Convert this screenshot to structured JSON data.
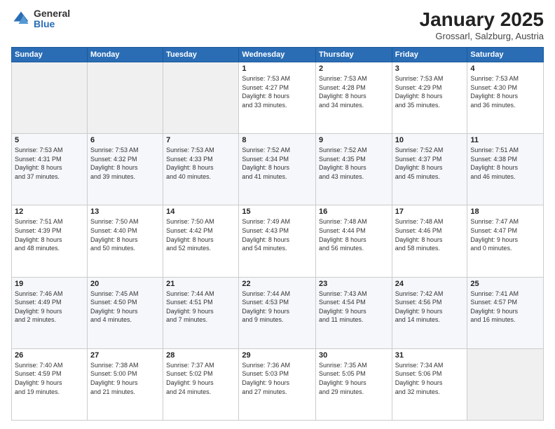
{
  "logo": {
    "general": "General",
    "blue": "Blue"
  },
  "header": {
    "title": "January 2025",
    "subtitle": "Grossarl, Salzburg, Austria"
  },
  "weekdays": [
    "Sunday",
    "Monday",
    "Tuesday",
    "Wednesday",
    "Thursday",
    "Friday",
    "Saturday"
  ],
  "weeks": [
    [
      {
        "day": "",
        "info": ""
      },
      {
        "day": "",
        "info": ""
      },
      {
        "day": "",
        "info": ""
      },
      {
        "day": "1",
        "info": "Sunrise: 7:53 AM\nSunset: 4:27 PM\nDaylight: 8 hours\nand 33 minutes."
      },
      {
        "day": "2",
        "info": "Sunrise: 7:53 AM\nSunset: 4:28 PM\nDaylight: 8 hours\nand 34 minutes."
      },
      {
        "day": "3",
        "info": "Sunrise: 7:53 AM\nSunset: 4:29 PM\nDaylight: 8 hours\nand 35 minutes."
      },
      {
        "day": "4",
        "info": "Sunrise: 7:53 AM\nSunset: 4:30 PM\nDaylight: 8 hours\nand 36 minutes."
      }
    ],
    [
      {
        "day": "5",
        "info": "Sunrise: 7:53 AM\nSunset: 4:31 PM\nDaylight: 8 hours\nand 37 minutes."
      },
      {
        "day": "6",
        "info": "Sunrise: 7:53 AM\nSunset: 4:32 PM\nDaylight: 8 hours\nand 39 minutes."
      },
      {
        "day": "7",
        "info": "Sunrise: 7:53 AM\nSunset: 4:33 PM\nDaylight: 8 hours\nand 40 minutes."
      },
      {
        "day": "8",
        "info": "Sunrise: 7:52 AM\nSunset: 4:34 PM\nDaylight: 8 hours\nand 41 minutes."
      },
      {
        "day": "9",
        "info": "Sunrise: 7:52 AM\nSunset: 4:35 PM\nDaylight: 8 hours\nand 43 minutes."
      },
      {
        "day": "10",
        "info": "Sunrise: 7:52 AM\nSunset: 4:37 PM\nDaylight: 8 hours\nand 45 minutes."
      },
      {
        "day": "11",
        "info": "Sunrise: 7:51 AM\nSunset: 4:38 PM\nDaylight: 8 hours\nand 46 minutes."
      }
    ],
    [
      {
        "day": "12",
        "info": "Sunrise: 7:51 AM\nSunset: 4:39 PM\nDaylight: 8 hours\nand 48 minutes."
      },
      {
        "day": "13",
        "info": "Sunrise: 7:50 AM\nSunset: 4:40 PM\nDaylight: 8 hours\nand 50 minutes."
      },
      {
        "day": "14",
        "info": "Sunrise: 7:50 AM\nSunset: 4:42 PM\nDaylight: 8 hours\nand 52 minutes."
      },
      {
        "day": "15",
        "info": "Sunrise: 7:49 AM\nSunset: 4:43 PM\nDaylight: 8 hours\nand 54 minutes."
      },
      {
        "day": "16",
        "info": "Sunrise: 7:48 AM\nSunset: 4:44 PM\nDaylight: 8 hours\nand 56 minutes."
      },
      {
        "day": "17",
        "info": "Sunrise: 7:48 AM\nSunset: 4:46 PM\nDaylight: 8 hours\nand 58 minutes."
      },
      {
        "day": "18",
        "info": "Sunrise: 7:47 AM\nSunset: 4:47 PM\nDaylight: 9 hours\nand 0 minutes."
      }
    ],
    [
      {
        "day": "19",
        "info": "Sunrise: 7:46 AM\nSunset: 4:49 PM\nDaylight: 9 hours\nand 2 minutes."
      },
      {
        "day": "20",
        "info": "Sunrise: 7:45 AM\nSunset: 4:50 PM\nDaylight: 9 hours\nand 4 minutes."
      },
      {
        "day": "21",
        "info": "Sunrise: 7:44 AM\nSunset: 4:51 PM\nDaylight: 9 hours\nand 7 minutes."
      },
      {
        "day": "22",
        "info": "Sunrise: 7:44 AM\nSunset: 4:53 PM\nDaylight: 9 hours\nand 9 minutes."
      },
      {
        "day": "23",
        "info": "Sunrise: 7:43 AM\nSunset: 4:54 PM\nDaylight: 9 hours\nand 11 minutes."
      },
      {
        "day": "24",
        "info": "Sunrise: 7:42 AM\nSunset: 4:56 PM\nDaylight: 9 hours\nand 14 minutes."
      },
      {
        "day": "25",
        "info": "Sunrise: 7:41 AM\nSunset: 4:57 PM\nDaylight: 9 hours\nand 16 minutes."
      }
    ],
    [
      {
        "day": "26",
        "info": "Sunrise: 7:40 AM\nSunset: 4:59 PM\nDaylight: 9 hours\nand 19 minutes."
      },
      {
        "day": "27",
        "info": "Sunrise: 7:38 AM\nSunset: 5:00 PM\nDaylight: 9 hours\nand 21 minutes."
      },
      {
        "day": "28",
        "info": "Sunrise: 7:37 AM\nSunset: 5:02 PM\nDaylight: 9 hours\nand 24 minutes."
      },
      {
        "day": "29",
        "info": "Sunrise: 7:36 AM\nSunset: 5:03 PM\nDaylight: 9 hours\nand 27 minutes."
      },
      {
        "day": "30",
        "info": "Sunrise: 7:35 AM\nSunset: 5:05 PM\nDaylight: 9 hours\nand 29 minutes."
      },
      {
        "day": "31",
        "info": "Sunrise: 7:34 AM\nSunset: 5:06 PM\nDaylight: 9 hours\nand 32 minutes."
      },
      {
        "day": "",
        "info": ""
      }
    ]
  ]
}
